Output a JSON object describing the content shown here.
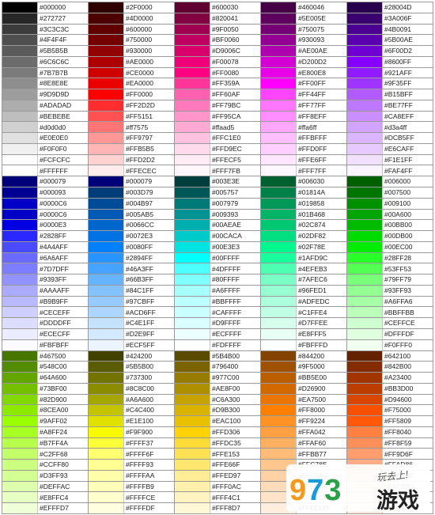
{
  "watermark": {
    "logo_parts": [
      "9",
      "7",
      "3"
    ],
    "slogan": "玩去上!",
    "site_name": "游戏"
  },
  "columns": [
    [
      "#000000",
      "#272727",
      "#3C3C3C",
      "#4F4F4F",
      "#5B5B5B",
      "#6C6C6C",
      "#7B7B7B",
      "#8E8E8E",
      "#9D9D9D",
      "#ADADAD",
      "#BEBEBE",
      "#d0d0d0",
      "#E0E0E0",
      "#F0F0F0",
      "#FCFCFC",
      "#FFFFFF",
      "#000079",
      "#000093",
      "#0000C6",
      "#0000C6",
      "#0000E3",
      "#2828FF",
      "#4A4AFF",
      "#6A6AFF",
      "#7D7DFF",
      "#9393FF",
      "#AAAAFF",
      "#B9B9FF",
      "#CECEFF",
      "#DDDDFF",
      "#ECECFF",
      "#FBFBFF",
      "#467500",
      "#548C00",
      "#64A600",
      "#73BF00",
      "#82D900",
      "#8CEA00",
      "#9AFF02",
      "#A8FF24",
      "#B7FF4A",
      "#C2FF68",
      "#CCFF80",
      "#D3FF93",
      "#DEFFAC",
      "#E8FFC4",
      "#EFFFD7"
    ],
    [
      "#2F0000",
      "#4D0000",
      "#600000",
      "#750000",
      "#930000",
      "#AE0000",
      "#CE0000",
      "#EA0000",
      "#FF0000",
      "#FF2D2D",
      "#FF5151",
      "#ff7575",
      "#FF9797",
      "#FFB5B5",
      "#FFD2D2",
      "#FFECEC",
      "#000079",
      "#003D79",
      "#004B97",
      "#005AB5",
      "#0066CC",
      "#0072E3",
      "#0080FF",
      "#2894FF",
      "#46A3FF",
      "#66B3FF",
      "#84C1FF",
      "#97CBFF",
      "#ACD6FF",
      "#C4E1FF",
      "#D2E9FF",
      "#ECF5FF",
      "#424200",
      "#5B5B00",
      "#737300",
      "#8C8C00",
      "#A6A600",
      "#C4C400",
      "#E1E100",
      "#F9F900",
      "#FFFF37",
      "#FFFF6F",
      "#FFFF93",
      "#FFFFAA",
      "#FFFFB9",
      "#FFFFCE",
      "#FFFFDF"
    ],
    [
      "#600030",
      "#820041",
      "#9F0050",
      "#BF0060",
      "#D9006C",
      "#F00078",
      "#FF0080",
      "#FF359A",
      "#FF60AF",
      "#FF79BC",
      "#FF95CA",
      "#ffaad5",
      "#FFC1E0",
      "#FFD9EC",
      "#FFECF5",
      "#FFF7FB",
      "#003E3E",
      "#005757",
      "#007979",
      "#009393",
      "#00AEAE",
      "#00CACA",
      "#00E3E3",
      "#00FFFF",
      "#4DFFFF",
      "#80FFFF",
      "#A6FFFF",
      "#BBFFFF",
      "#CAFFFF",
      "#D9FFFF",
      "#ECFFFF",
      "#FDFFFF",
      "#5B4B00",
      "#796400",
      "#977C00",
      "#AE8F00",
      "#C6A300",
      "#D9B300",
      "#EAC100",
      "#FFD306",
      "#FFDC35",
      "#FFE153",
      "#FFE66F",
      "#FFED97",
      "#FFF0AC",
      "#FFF4C1",
      "#FFF8D7"
    ],
    [
      "#460046",
      "#5E005E",
      "#750075",
      "#930093",
      "#AE00AE",
      "#D200D2",
      "#E800E8",
      "#FF00FF",
      "#FF44FF",
      "#FF77FF",
      "#FF8EFF",
      "#ffa6ff",
      "#FFBFFF",
      "#FFD0FF",
      "#FFE6FF",
      "#FFF7FF",
      "#006030",
      "#01814A",
      "#019858",
      "#01B468",
      "#02C874",
      "#02DF82",
      "#02F78E",
      "#1AFD9C",
      "#4EFEB3",
      "#7AFEC6",
      "#96FED1",
      "#ADFEDC",
      "#C1FFE4",
      "#D7FFEE",
      "#E8FFF5",
      "#FBFFFD",
      "#844200",
      "#9F5000",
      "#BB5E00",
      "#D26900",
      "#EA7500",
      "#FF8000",
      "#FF9224",
      "#FFA042",
      "#FFAF60",
      "#FFBB77",
      "#FFC78E",
      "#FFD1A4",
      "#FFDCB9",
      "#FFE4CA",
      "#FFEEDD"
    ],
    [
      "#28004D",
      "#3A006F",
      "#4B0091",
      "#5B00AE",
      "#6F00D2",
      "#8600FF",
      "#921AFF",
      "#9F35FF",
      "#B15BFF",
      "#BE77FF",
      "#CA8EFF",
      "#d3a4ff",
      "#DCB5FF",
      "#E6CAFF",
      "#F1E1FF",
      "#FAF4FF",
      "#006000",
      "#007500",
      "#009100",
      "#00A600",
      "#00BB00",
      "#00DB00",
      "#00EC00",
      "#28FF28",
      "#53FF53",
      "#79FF79",
      "#93FF93",
      "#A6FFA6",
      "#BBFFBB",
      "#CEFFCE",
      "#DFFFDF",
      "#F0FFF0",
      "#642100",
      "#842B00",
      "#A23400",
      "#BB3D00",
      "#D94600",
      "#F75000",
      "#FF5809",
      "#FF8040",
      "#FF8F59",
      "#FF9D6F",
      "#FFAD86",
      "#FFBD9D",
      "#FFCBB3",
      "#FFDAC8",
      "#FFE6D9"
    ]
  ]
}
